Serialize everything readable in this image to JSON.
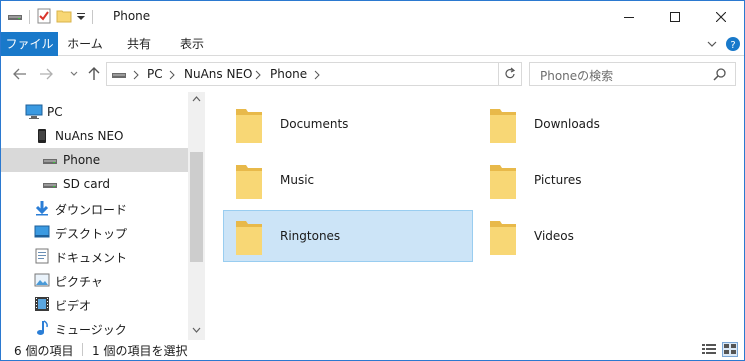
{
  "window": {
    "title": "Phone"
  },
  "ribbon": {
    "tabs": [
      {
        "label": "ファイル"
      },
      {
        "label": "ホーム"
      },
      {
        "label": "共有"
      },
      {
        "label": "表示"
      }
    ]
  },
  "address": {
    "breadcrumbs": [
      "PC",
      "NuAns NEO",
      "Phone"
    ]
  },
  "search": {
    "placeholder": "Phoneの検索"
  },
  "nav": {
    "items": [
      {
        "label": "PC",
        "icon": "pc-icon"
      },
      {
        "label": "NuAns NEO",
        "icon": "phone-device-icon"
      },
      {
        "label": "Phone",
        "icon": "drive-icon",
        "selected": true
      },
      {
        "label": "SD card",
        "icon": "drive-icon"
      },
      {
        "label": "ダウンロード",
        "icon": "download-icon"
      },
      {
        "label": "デスクトップ",
        "icon": "desktop-icon"
      },
      {
        "label": "ドキュメント",
        "icon": "document-icon"
      },
      {
        "label": "ピクチャ",
        "icon": "pictures-icon"
      },
      {
        "label": "ビデオ",
        "icon": "videos-icon"
      },
      {
        "label": "ミュージック",
        "icon": "music-icon"
      }
    ]
  },
  "folders": [
    {
      "name": "Documents"
    },
    {
      "name": "Downloads"
    },
    {
      "name": "Music"
    },
    {
      "name": "Pictures"
    },
    {
      "name": "Ringtones",
      "selected": true
    },
    {
      "name": "Videos"
    }
  ],
  "status": {
    "item_count": "6 個の項目",
    "selection": "1 個の項目を選択"
  },
  "colors": {
    "accent": "#1979ca",
    "selection_bg": "#cce4f7",
    "selection_border": "#99cdf0",
    "folder_yellow": "#f8d775",
    "nav_selected": "#d9d9d9"
  }
}
